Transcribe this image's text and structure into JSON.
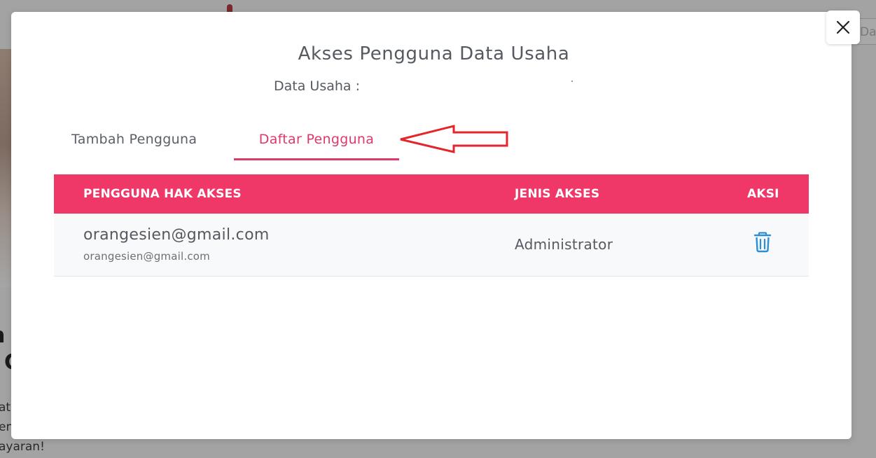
{
  "background": {
    "search_fragment": "Da",
    "heading_line1": "n",
    "heading_line2": "C",
    "text_line1": "at",
    "text_line2": "en",
    "text_line3": "ayaran!"
  },
  "modal": {
    "title": "Akses Pengguna Data Usaha",
    "subtitle_label": "Data Usaha :",
    "close_icon": "close-icon"
  },
  "tabs": [
    {
      "label": "Tambah Pengguna",
      "active": false
    },
    {
      "label": "Daftar Pengguna",
      "active": true
    }
  ],
  "table": {
    "headers": {
      "user": "PENGGUNA HAK AKSES",
      "type": "JENIS AKSES",
      "action": "AKSI"
    },
    "rows": [
      {
        "email": "orangesien@gmail.com",
        "email_sub": "orangesien@gmail.com",
        "access_type": "Administrator",
        "action_icon": "trash-icon"
      }
    ]
  },
  "colors": {
    "accent": "#ef3868",
    "tab_active": "#e0386a",
    "trash_icon": "#2b8fd6",
    "annotation_arrow": "#e3262b"
  }
}
